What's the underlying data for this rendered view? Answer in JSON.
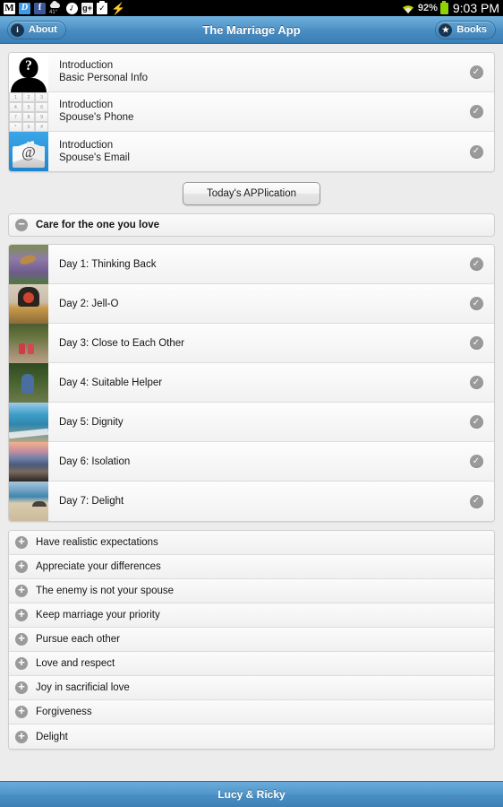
{
  "status_bar": {
    "icons": [
      "gmail-icon",
      "dropbox-icon",
      "facebook-icon",
      "weather-icon",
      "check-circle-icon",
      "google-plus-icon",
      "tasks-icon",
      "lightning-icon"
    ],
    "gmail_glyph": "M",
    "dropbox_glyph": "D",
    "facebook_glyph": "f",
    "weather_temp": "41°",
    "check_glyph": "✓",
    "gplus_glyph": "g+",
    "task_glyph": "✓",
    "bolt_glyph": "⚡",
    "battery_percent": "92%",
    "clock": "9:03 PM"
  },
  "title_bar": {
    "about_label": "About",
    "about_icon_glyph": "i",
    "title": "The Marriage App",
    "books_label": "Books",
    "books_icon_glyph": "★"
  },
  "intro_card": {
    "rows": [
      {
        "line1": "Introduction",
        "line2": "Basic Personal Info",
        "thumb": "person-question-icon",
        "check": "✓"
      },
      {
        "line1": "Introduction",
        "line2": "Spouse's Phone",
        "thumb": "keypad-icon",
        "check": "✓"
      },
      {
        "line1": "Introduction",
        "line2": "Spouse's Email",
        "thumb": "email-at-icon",
        "check": "✓"
      }
    ]
  },
  "keypad_keys": [
    "1",
    "2",
    "3",
    "4",
    "5",
    "6",
    "7",
    "8",
    "9",
    "*",
    "0",
    "#"
  ],
  "todays_application": {
    "label": "Today's APPlication"
  },
  "expanded_section": {
    "label": "Care for the one you love",
    "toggle_glyph": "−",
    "days": [
      {
        "title": "Day 1: Thinking Back",
        "thumb": "butterfly-lavender-photo",
        "check": "✓"
      },
      {
        "title": "Day 2: Jell-O",
        "thumb": "dinner-table-photo",
        "check": "✓"
      },
      {
        "title": "Day 3: Close to Each Other",
        "thumb": "couple-creek-photo",
        "check": "✓"
      },
      {
        "title": "Day 4: Suitable Helper",
        "thumb": "couple-forest-photo",
        "check": "✓"
      },
      {
        "title": "Day 5: Dignity",
        "thumb": "coastline-photo",
        "check": "✓"
      },
      {
        "title": "Day 6: Isolation",
        "thumb": "sunset-beach-photo",
        "check": "✓"
      },
      {
        "title": "Day 7: Delight",
        "thumb": "beach-umbrella-photo",
        "check": "✓"
      }
    ]
  },
  "collapsed_sections": {
    "toggle_glyph": "+",
    "items": [
      {
        "label": "Have realistic expectations"
      },
      {
        "label": "Appreciate your differences"
      },
      {
        "label": "The enemy is not your spouse"
      },
      {
        "label": "Keep marriage your priority"
      },
      {
        "label": "Pursue each other"
      },
      {
        "label": "Love and respect"
      },
      {
        "label": "Joy in sacrificial love"
      },
      {
        "label": "Forgiveness"
      },
      {
        "label": "Delight"
      }
    ]
  },
  "footer": {
    "label": "Lucy & Ricky"
  },
  "colors": {
    "accent_blue": "#4f93c7",
    "footer_blue": "#5096c9",
    "page_background": "#ececec",
    "check_gray": "#9a9a9a",
    "battery_green": "#8fd400"
  }
}
